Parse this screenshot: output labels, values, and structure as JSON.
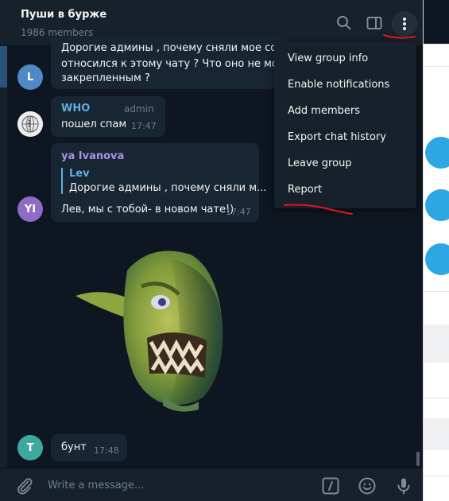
{
  "header": {
    "title": "Пуши в бурже",
    "subtitle": "1986 members"
  },
  "messages": [
    {
      "id": "lev",
      "avatar_letter": "L",
      "avatar_color": "#4f8ac6",
      "lines": [
        "Дорогие админы , почему сняли мое сообщ",
        "относился к этому чату ? Что оно не могло",
        "закрепленным ?"
      ]
    },
    {
      "id": "who",
      "sender": "WHO",
      "sender_color": "#5eaedf",
      "role": "admin",
      "text": "пошел спам",
      "time": "17:47"
    },
    {
      "id": "ivanova",
      "avatar_letter": "YI",
      "avatar_color": "#8e6cc5",
      "sender": "ya Ivanova",
      "sender_color": "#a695e7",
      "quote_name": "Lev",
      "quote_text": "Дорогие админы , почему сняли м...",
      "text": "Лев, мы с тобой- в новом чате!)",
      "time": "17:47"
    },
    {
      "id": "t",
      "avatar_letter": "T",
      "avatar_color": "#3ea8a0",
      "text": "бунт",
      "time": "17:48"
    }
  ],
  "menu": {
    "items": [
      "View group info",
      "Enable notifications",
      "Add members",
      "Export chat history",
      "Leave group",
      "Report"
    ]
  },
  "composer": {
    "placeholder": "Write a message..."
  },
  "colors": {
    "accent": "#5eaedf",
    "background": "#0e1621",
    "panel": "#17212b",
    "bubble": "#182533",
    "annotation": "#e0141e"
  }
}
